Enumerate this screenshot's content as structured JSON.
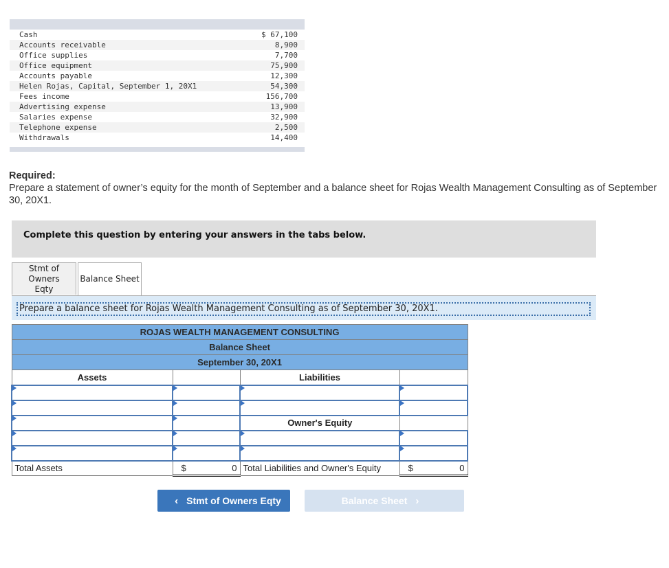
{
  "given_accounts": [
    {
      "label": "Cash",
      "amount": "$ 67,100"
    },
    {
      "label": "Accounts receivable",
      "amount": "8,900"
    },
    {
      "label": "Office supplies",
      "amount": "7,700"
    },
    {
      "label": "Office equipment",
      "amount": "75,900"
    },
    {
      "label": "Accounts payable",
      "amount": "12,300"
    },
    {
      "label": "Helen Rojas, Capital, September 1, 20X1",
      "amount": "54,300"
    },
    {
      "label": "Fees income",
      "amount": "156,700"
    },
    {
      "label": "Advertising expense",
      "amount": "13,900"
    },
    {
      "label": "Salaries expense",
      "amount": "32,900"
    },
    {
      "label": "Telephone expense",
      "amount": "2,500"
    },
    {
      "label": "Withdrawals",
      "amount": "14,400"
    }
  ],
  "required": {
    "label": "Required:",
    "text": "Prepare a statement of owner’s equity for the month of September and a balance sheet for Rojas Wealth Management Consulting as of September 30, 20X1."
  },
  "instruction": "Complete this question by entering your answers in the tabs below.",
  "tabs": [
    {
      "label": "Stmt of Owners Eqty",
      "active": false
    },
    {
      "label": "Balance Sheet",
      "active": true
    }
  ],
  "prompt": "Prepare a balance sheet for Rojas Wealth Management Consulting as of September 30, 20X1.",
  "balance_sheet": {
    "company": "ROJAS WEALTH MANAGEMENT CONSULTING",
    "title": "Balance Sheet",
    "date": "September 30, 20X1",
    "assets_header": "Assets",
    "liabilities_header": "Liabilities",
    "owners_equity_header": "Owner's Equity",
    "total_assets_label": "Total Assets",
    "total_assets_currency": "$",
    "total_assets_value": "0",
    "total_liab_equity_label": "Total Liabilities and Owner's Equity",
    "total_liab_equity_currency": "$",
    "total_liab_equity_value": "0"
  },
  "nav": {
    "prev_label": "Stmt of Owners Eqty",
    "next_label": "Balance Sheet"
  }
}
